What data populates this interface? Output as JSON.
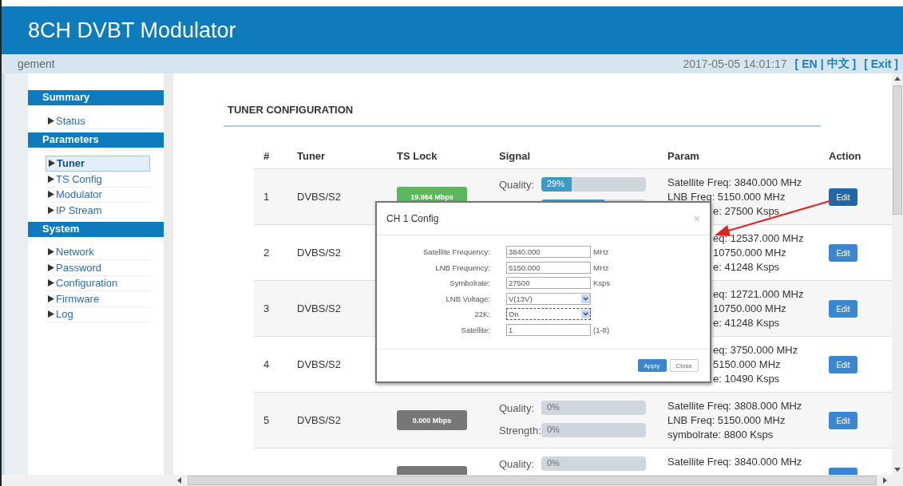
{
  "header": {
    "title": "8CH DVBT Modulator"
  },
  "subbar": {
    "breadcrumb": "gement",
    "datetime": "2017-05-05 14:01:17",
    "language_switch": {
      "open": "[",
      "options": [
        "EN",
        "中文"
      ],
      "separator": "|",
      "close": "]"
    },
    "exit": "[ Exit ]"
  },
  "sidebar": [
    {
      "title": "Summary",
      "items": [
        {
          "label": "Status",
          "selected": false
        }
      ]
    },
    {
      "title": "Parameters",
      "items": [
        {
          "label": "Tuner",
          "selected": true
        },
        {
          "label": "TS Config",
          "selected": false
        },
        {
          "label": "Modulator",
          "selected": false
        },
        {
          "label": "IP Stream",
          "selected": false
        }
      ]
    },
    {
      "title": "System",
      "items": [
        {
          "label": "Network",
          "selected": false
        },
        {
          "label": "Password",
          "selected": false
        },
        {
          "label": "Configuration",
          "selected": false
        },
        {
          "label": "Firmware",
          "selected": false
        },
        {
          "label": "Log",
          "selected": false
        }
      ]
    }
  ],
  "section_title": "TUNER CONFIGURATION",
  "table": {
    "columns": [
      "#",
      "Tuner",
      "TS Lock",
      "Signal",
      "Param",
      "Action"
    ],
    "rows": [
      {
        "index": "1",
        "tuner": "DVBS/S2",
        "ts_lock": {
          "text": "19.964 Mbps",
          "locked": true
        },
        "signal": [
          {
            "label": "Quality:",
            "text": "29%",
            "level": 0.29
          },
          {
            "level": 0.6
          }
        ],
        "param": [
          {
            "kind": "full",
            "text": "Satellite Freq: 3840.000 MHz"
          },
          {
            "kind": "full",
            "text": "LNB Freq: 5150.000 MHz"
          },
          {
            "kind": "cut",
            "text": "e: 27500 Ksps"
          }
        ],
        "action": "Edit",
        "action_pressed": true
      },
      {
        "index": "2",
        "tuner": "DVBS/S2",
        "param": [
          {
            "kind": "cut",
            "text": "eq: 12537.000 MHz"
          },
          {
            "kind": "cut",
            "text": "10750.000 MHz"
          },
          {
            "kind": "cut",
            "text": "e: 41248 Ksps"
          }
        ],
        "action": "Edit",
        "action_pressed": false
      },
      {
        "index": "3",
        "tuner": "DVBS/S2",
        "param": [
          {
            "kind": "cut",
            "text": "eq: 12721.000 MHz"
          },
          {
            "kind": "cut",
            "text": "10750.000 MHz"
          },
          {
            "kind": "cut",
            "text": "e: 41248 Ksps"
          }
        ],
        "action": "Edit",
        "action_pressed": false
      },
      {
        "index": "4",
        "tuner": "DVBS/S2",
        "param": [
          {
            "kind": "cut",
            "text": "eq: 3750.000 MHz"
          },
          {
            "kind": "cut",
            "text": "5150.000 MHz"
          },
          {
            "kind": "cut",
            "text": "e: 10490 Ksps"
          }
        ],
        "action": "Edit",
        "action_pressed": false
      },
      {
        "index": "5",
        "tuner": "DVBS/S2",
        "ts_lock": {
          "text": "0.000 Mbps",
          "locked": false
        },
        "signal": [
          {
            "label": "Quality:",
            "text": "0%",
            "level": 0
          },
          {
            "label": "Strength:",
            "text": "0%",
            "level": 0
          }
        ],
        "param": [
          {
            "kind": "full",
            "text": "Satellite Freq: 3808.000 MHz"
          },
          {
            "kind": "full",
            "text": "LNB Freq: 5150.000 MHz"
          },
          {
            "kind": "full",
            "text": "symbolrate: 8800 Ksps"
          }
        ],
        "action": "Edit",
        "action_pressed": false
      },
      {
        "ts_lock": {
          "locked": false
        },
        "signal": [
          {
            "label": "Quality:",
            "text": "0%",
            "level": 0
          }
        ],
        "param": [
          {
            "kind": "full",
            "text": "Satellite Freq: 3840.000 MHz"
          }
        ],
        "action_pressed": false
      }
    ]
  },
  "dialog": {
    "title": "CH 1 Config",
    "close": "×",
    "fields": [
      {
        "kind": "text",
        "label": "Satellite Frequency:",
        "value": "3840.000",
        "unit": "MHz"
      },
      {
        "kind": "text",
        "label": "LNB Frequency:",
        "value": "5150.000",
        "unit": "MHz"
      },
      {
        "kind": "text",
        "label": "Symbolrate:",
        "value": "27500",
        "unit": "Ksps"
      },
      {
        "kind": "select",
        "label": "LNB Voltage:",
        "value": "V(13V)",
        "focused": false
      },
      {
        "kind": "select",
        "label": "22K:",
        "value": "On",
        "focused": true
      },
      {
        "kind": "text",
        "label": "Satellite:",
        "value": "1",
        "unit": "(1-8)"
      }
    ],
    "buttons": [
      {
        "label": "Apply",
        "primary": true
      },
      {
        "label": "Close",
        "primary": false
      }
    ]
  }
}
